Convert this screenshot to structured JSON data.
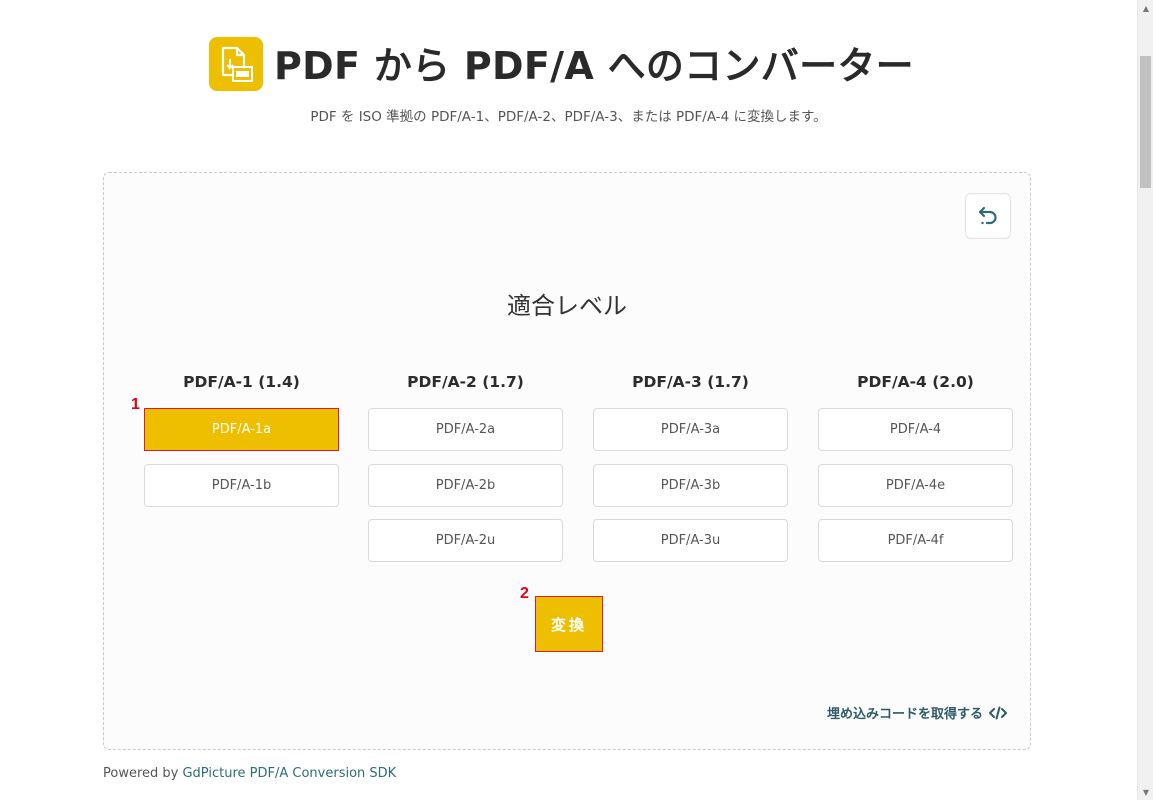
{
  "header": {
    "title": "PDF から PDF/A へのコンバーター",
    "subtitle": "PDF を ISO 準拠の PDF/A-1、PDF/A-2、PDF/A-3、または PDF/A-4 に変換します。"
  },
  "card": {
    "section_title": "適合レベル",
    "columns": [
      {
        "heading": "PDF/A-1 (1.4)",
        "options": [
          "PDF/A-1a",
          "PDF/A-1b"
        ]
      },
      {
        "heading": "PDF/A-2 (1.7)",
        "options": [
          "PDF/A-2a",
          "PDF/A-2b",
          "PDF/A-2u"
        ]
      },
      {
        "heading": "PDF/A-3 (1.7)",
        "options": [
          "PDF/A-3a",
          "PDF/A-3b",
          "PDF/A-3u"
        ]
      },
      {
        "heading": "PDF/A-4 (2.0)",
        "options": [
          "PDF/A-4",
          "PDF/A-4e",
          "PDF/A-4f"
        ]
      }
    ],
    "selected_option": "PDF/A-1a",
    "convert_label": "変換",
    "embed_link_label": "埋め込みコードを取得する"
  },
  "annotations": {
    "marker_1": "1",
    "marker_2": "2"
  },
  "footer": {
    "prefix": "Powered by ",
    "link": "GdPicture PDF/A Conversion SDK"
  },
  "colors": {
    "accent": "#eebf00",
    "highlight_border": "#e0183c",
    "link": "#2e5b66"
  }
}
